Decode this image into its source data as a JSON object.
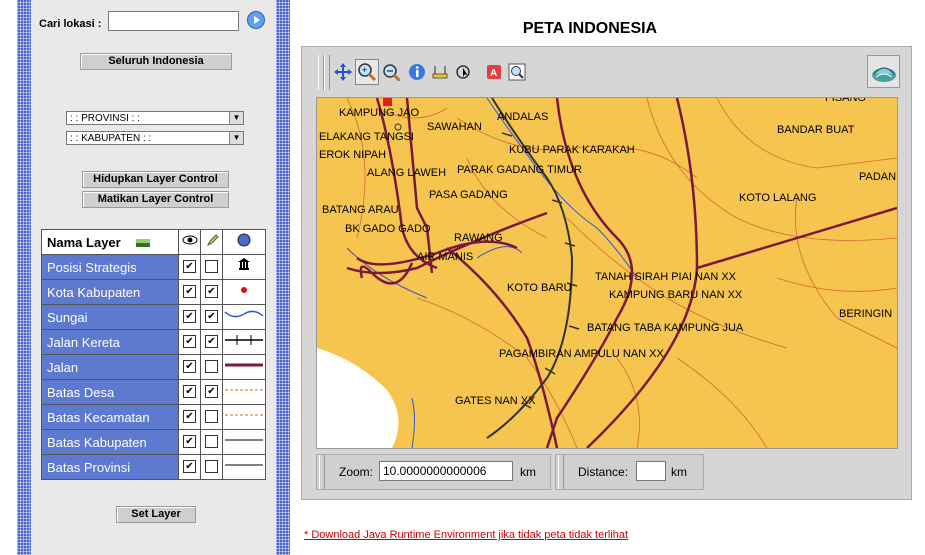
{
  "sidebar": {
    "search_label": "Cari lokasi :",
    "search_value": "",
    "whole_button": "Seluruh Indonesia",
    "province_select": ": : PROVINSI : :",
    "kabupaten_select": ": : KABUPATEN : :",
    "layer_on_button": "Hidupkan Layer Control",
    "layer_off_button": "Matikan Layer Control",
    "layer_header": "Nama Layer",
    "layers": [
      {
        "name": "Posisi Strategis",
        "visible": true,
        "label": false,
        "symbol": "temple-icon"
      },
      {
        "name": "Kota Kabupaten",
        "visible": true,
        "label": true,
        "symbol": "red-dot-icon"
      },
      {
        "name": "Sungai",
        "visible": true,
        "label": true,
        "symbol": "river-line-icon"
      },
      {
        "name": "Jalan Kereta",
        "visible": true,
        "label": true,
        "symbol": "railway-line-icon"
      },
      {
        "name": "Jalan",
        "visible": true,
        "label": false,
        "symbol": "road-line-icon"
      },
      {
        "name": "Batas Desa",
        "visible": true,
        "label": true,
        "symbol": "dashed-orange-line-icon"
      },
      {
        "name": "Batas Kecamatan",
        "visible": true,
        "label": false,
        "symbol": "dashed-orange-line-icon"
      },
      {
        "name": "Batas Kabupaten",
        "visible": true,
        "label": false,
        "symbol": "solid-line-icon"
      },
      {
        "name": "Batas Provinsi",
        "visible": true,
        "label": false,
        "symbol": "solid-line-icon"
      }
    ],
    "set_layer_button": "Set Layer"
  },
  "main": {
    "title": "PETA INDONESIA",
    "toolbar": [
      "pan-icon",
      "zoom-in-icon",
      "zoom-out-icon",
      "info-icon",
      "measure-icon",
      "select-icon",
      "print-icon",
      "zoom-extent-icon",
      "globe-icon"
    ],
    "map_labels": [
      "KAMPUNG JAO",
      "SAWAHAN",
      "ANDALAS",
      "FISANG",
      "BANDAR BUAT",
      "ELAKANG TANGSI",
      "KUBU PARAK KARAKAH",
      "EROK NIPAH",
      "PARAK GADANG TIMUR",
      "ALANG LAWEH",
      "PADAN",
      "PASA GADANG",
      "KOTO LALANG",
      "BATANG ARAU",
      "RAWANG",
      "BK GADO GADO",
      "AIR MANIS",
      "TANAH SIRAH PIAI NAN XX",
      "KOTO BARU",
      "KAMPUNG BARU NAN XX",
      "BERINGIN",
      "BATANG TABA KAMPUNG JUA",
      "PAGAMBIRAN AMPULU NAN XX",
      "GATES NAN XX"
    ],
    "zoom_label": "Zoom:",
    "zoom_value": "10.0000000000006",
    "zoom_unit": "km",
    "distance_label": "Distance:",
    "distance_value": "",
    "distance_unit": "km",
    "download_link": "* Download Java Runtime Environment jika tidak peta tidak terlihat"
  },
  "colors": {
    "land": "#f5c550",
    "sea": "#ffffff",
    "road": "#7a1a3a",
    "river": "#3355cc",
    "boundary": "#d46a2a",
    "layer_row": "#5d7ad0"
  }
}
